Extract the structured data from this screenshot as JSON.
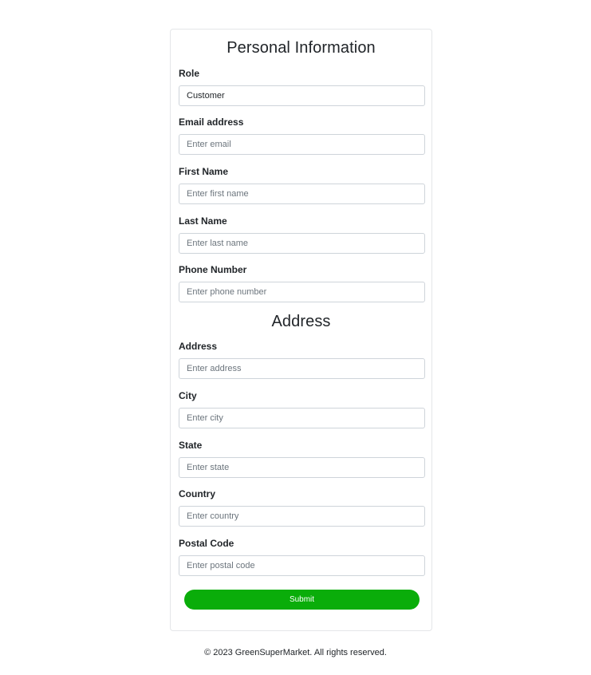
{
  "personal": {
    "title": "Personal Information",
    "fields": {
      "role": {
        "label": "Role",
        "value": "Customer",
        "placeholder": ""
      },
      "email": {
        "label": "Email address",
        "value": "",
        "placeholder": "Enter email"
      },
      "first_name": {
        "label": "First Name",
        "value": "",
        "placeholder": "Enter first name"
      },
      "last_name": {
        "label": "Last Name",
        "value": "",
        "placeholder": "Enter last name"
      },
      "phone": {
        "label": "Phone Number",
        "value": "",
        "placeholder": "Enter phone number"
      }
    }
  },
  "address": {
    "title": "Address",
    "fields": {
      "address": {
        "label": "Address",
        "value": "",
        "placeholder": "Enter address"
      },
      "city": {
        "label": "City",
        "value": "",
        "placeholder": "Enter city"
      },
      "state": {
        "label": "State",
        "value": "",
        "placeholder": "Enter state"
      },
      "country": {
        "label": "Country",
        "value": "",
        "placeholder": "Enter country"
      },
      "postal_code": {
        "label": "Postal Code",
        "value": "",
        "placeholder": "Enter postal code"
      }
    }
  },
  "submit_label": "Submit",
  "footer_text": "© 2023 GreenSuperMarket. All rights reserved.",
  "colors": {
    "accent": "#0aad0a",
    "border": "#ced4da",
    "text": "#212529",
    "placeholder": "#6c757d"
  }
}
